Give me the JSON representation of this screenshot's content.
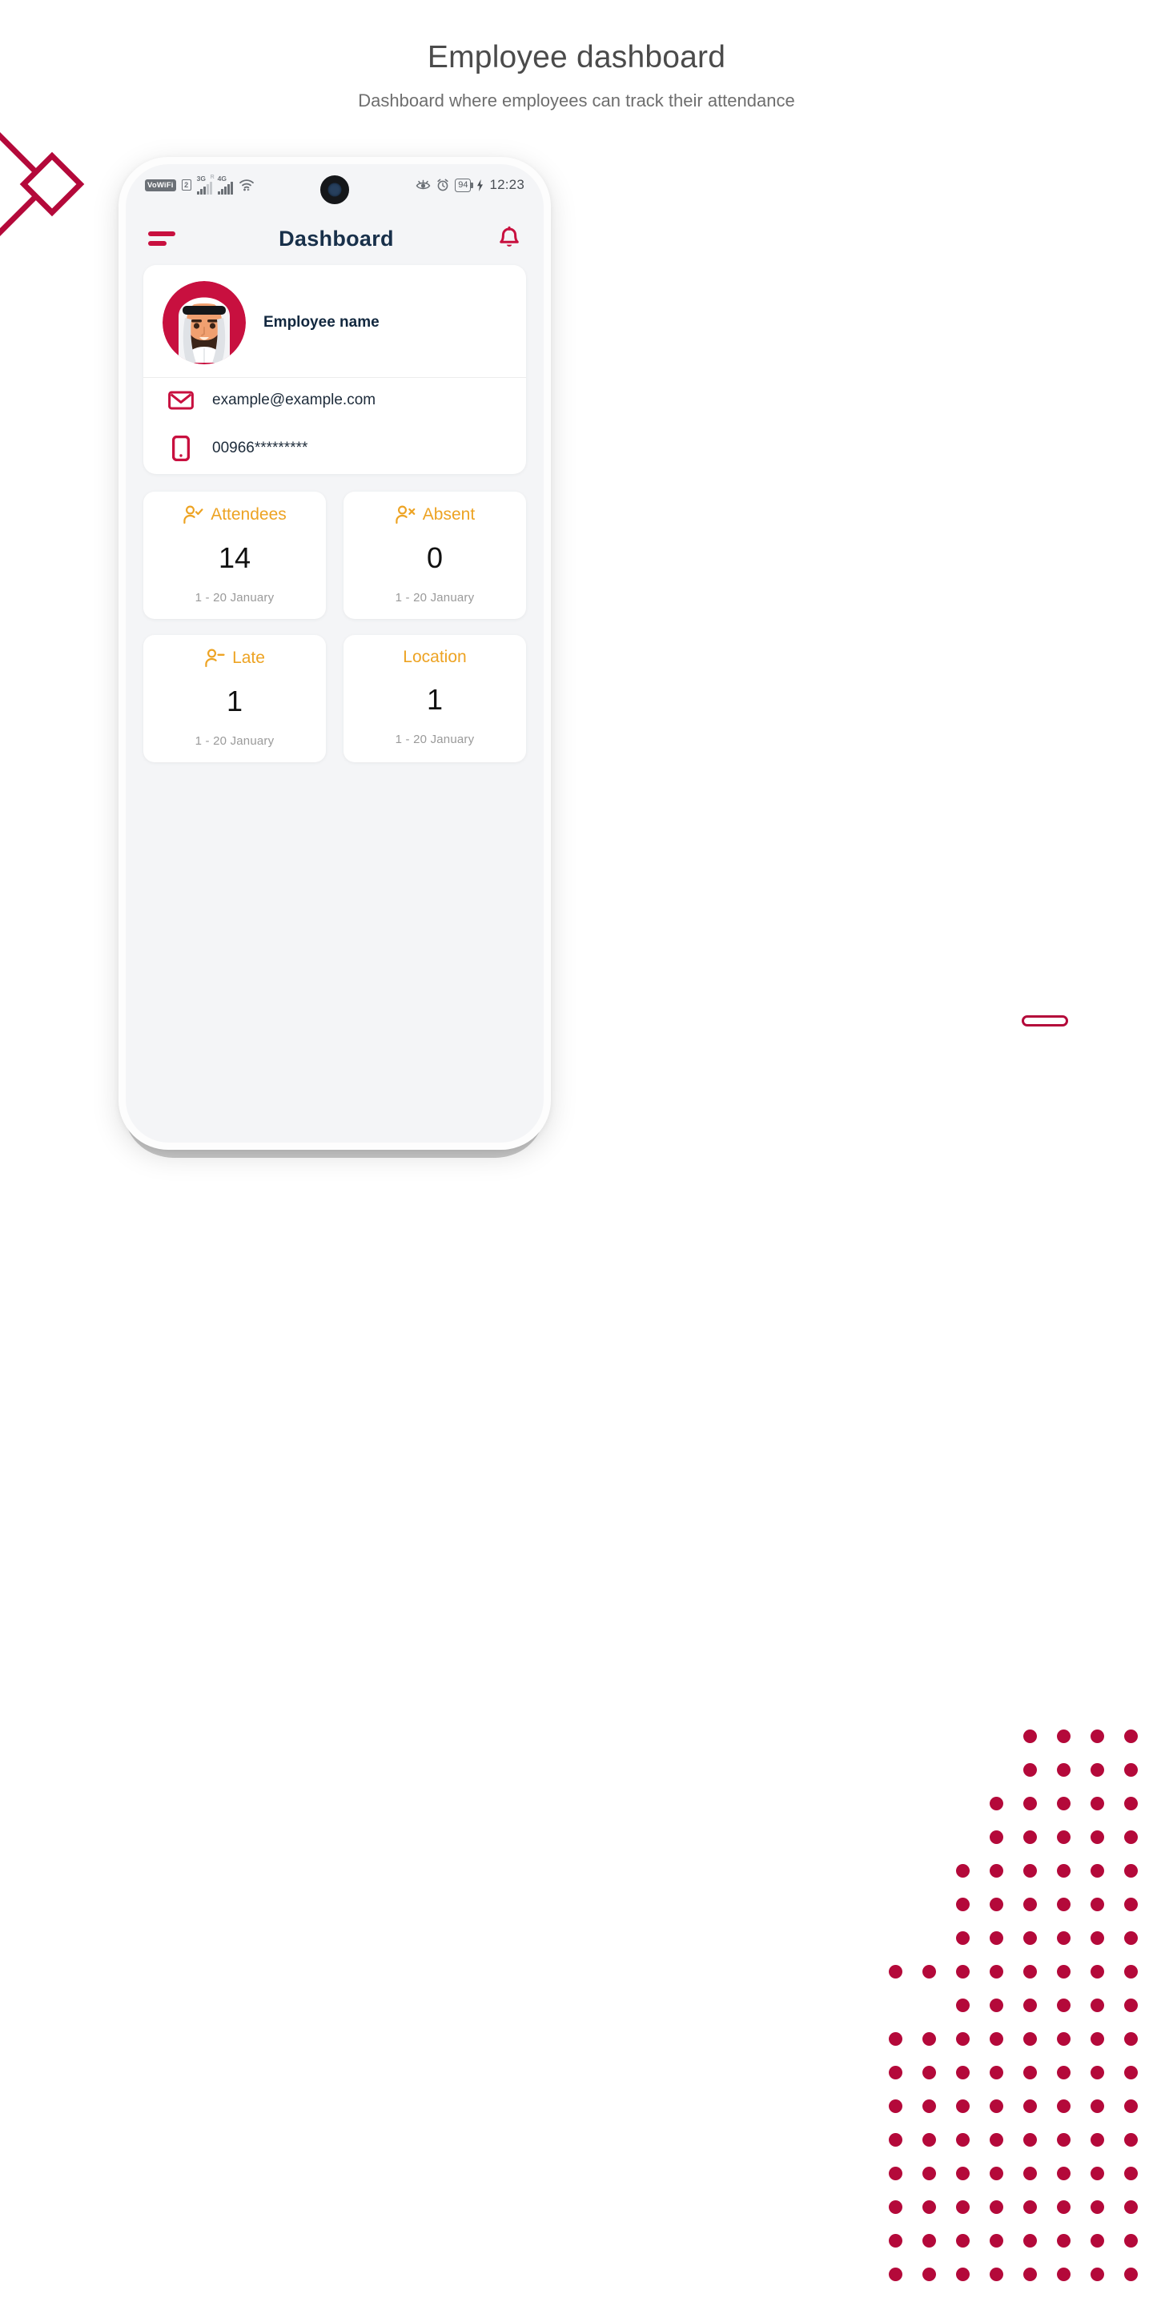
{
  "page": {
    "title": "Employee dashboard",
    "subtitle": "Dashboard where employees can track their attendance"
  },
  "status_bar": {
    "vowifi_label": "VoWiFi",
    "sim_label": "2",
    "network_1": "3G",
    "roaming_label": "R",
    "network_2": "4G",
    "battery_level": "94",
    "time": "12:23"
  },
  "app_header": {
    "title": "Dashboard",
    "menu_icon": "hamburger-menu-icon",
    "notification_icon": "bell-icon"
  },
  "profile": {
    "name": "Employee name",
    "avatar_icon": "employee-avatar",
    "email": "example@example.com",
    "email_icon": "envelope-icon",
    "phone": "00966*********",
    "phone_icon": "mobile-phone-icon"
  },
  "stats": [
    {
      "label": "Attendees",
      "value": "14",
      "period": "1 - 20 January",
      "icon": "person-check-icon"
    },
    {
      "label": "Absent",
      "value": "0",
      "period": "1 - 20 January",
      "icon": "person-x-icon"
    },
    {
      "label": "Late",
      "value": "1",
      "period": "1 - 20 January",
      "icon": "person-minus-icon"
    },
    {
      "label": "Location",
      "value": "1",
      "period": "1 - 20 January",
      "icon": ""
    }
  ],
  "colors": {
    "brand_crimson": "#b4093a",
    "accent_amber": "#eda323",
    "title_navy": "#18304a",
    "screen_bg": "#f4f5f7"
  }
}
